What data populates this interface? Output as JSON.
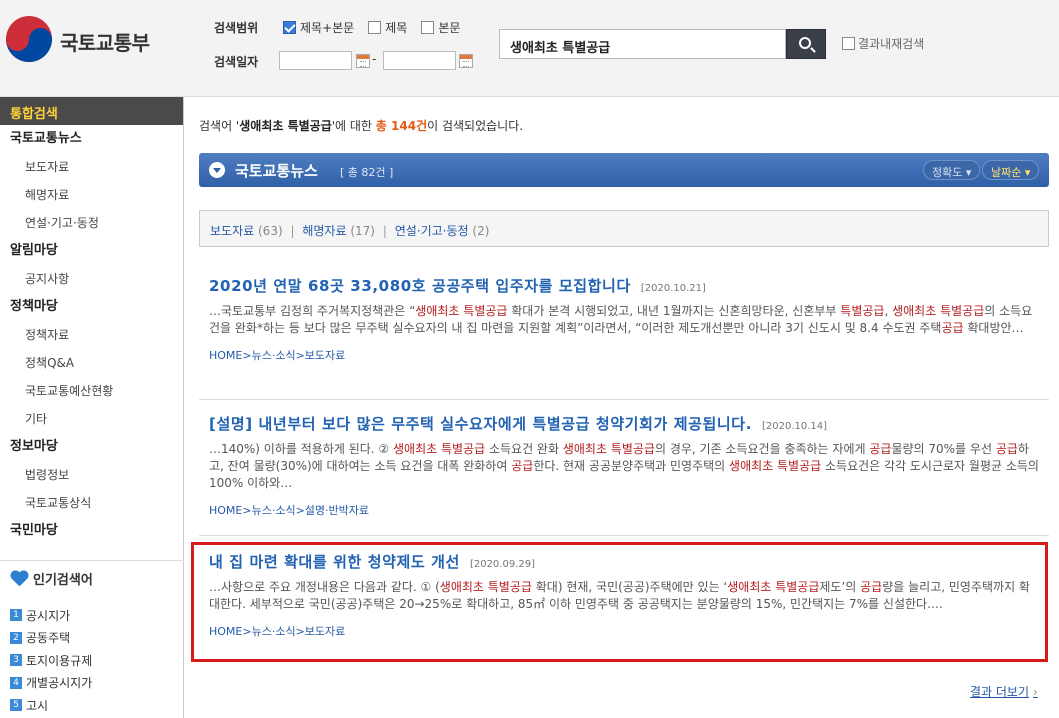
{
  "header": {
    "logo_text": "국토교통부",
    "scope_label": "검색범위",
    "scope_options": [
      {
        "label": "제목+본문",
        "checked": true
      },
      {
        "label": "제목",
        "checked": false
      },
      {
        "label": "본문",
        "checked": false
      }
    ],
    "date_label": "검색일자",
    "date_separator": "-",
    "search_value": "생애최초 특별공급",
    "within_label": "결과내재검색"
  },
  "sidebar": {
    "title": "통합검색",
    "categories": [
      {
        "label": "국토교통뉴스",
        "items": [
          "보도자료",
          "해명자료",
          "연설·기고·동정"
        ]
      },
      {
        "label": "알림마당",
        "items": [
          "공지사항"
        ]
      },
      {
        "label": "정책마당",
        "items": [
          "정책자료",
          "정책Q&A",
          "국토교통예산현황",
          "기타"
        ]
      },
      {
        "label": "정보마당",
        "items": [
          "법령정보",
          "국토교통상식"
        ]
      },
      {
        "label": "국민마당",
        "items": []
      }
    ],
    "popular_title": "인기검색어",
    "popular": [
      {
        "rank": "1",
        "label": "공시지가"
      },
      {
        "rank": "2",
        "label": "공동주택"
      },
      {
        "rank": "3",
        "label": "토지이용규제"
      },
      {
        "rank": "4",
        "label": "개별공시지가"
      },
      {
        "rank": "5",
        "label": "고시"
      }
    ]
  },
  "main": {
    "summary_prefix": "검색어 '",
    "summary_keyword": "생애최초 특별공급",
    "summary_mid": "'에 대한 ",
    "summary_count": "총 144건",
    "summary_suffix": "이 검색되었습니다.",
    "section_title": "국토교통뉴스",
    "section_count": "[ 총 82건 ]",
    "sort_accuracy": "정확도 ▾",
    "sort_date": "날짜순 ▾",
    "filters": [
      {
        "label": "보도자료",
        "count": "(63)"
      },
      {
        "label": "해명자료",
        "count": "(17)"
      },
      {
        "label": "연설·기고·동정",
        "count": "(2)"
      }
    ],
    "results": [
      {
        "title": "2020년 연말 68곳 33,080호 공공주택 입주자를 모집합니다",
        "date": "[2020.10.21]",
        "body": [
          {
            "t": "…국토교통부 김정희 주거복지정책관은 “"
          },
          {
            "t": "생애최초 특별공급",
            "hl": true
          },
          {
            "t": " 확대가 본격 시행되었고, 내년 1월까지는 신혼희망타운, 신혼부부 "
          },
          {
            "t": "특별공급",
            "hl": true
          },
          {
            "t": ", "
          },
          {
            "t": "생애최초 특별공급",
            "hl": true
          },
          {
            "t": "의 소득요건을 완화*하는 등 보다 많은 무주택 실수요자의 내 집 마련을 지원할 계획”이라면서, “이러한 제도개선뿐만 아니라 3기 신도시 및 8.4 수도권 주택"
          },
          {
            "t": "공급",
            "hl": true
          },
          {
            "t": " 확대방안…"
          }
        ],
        "path": "HOME>뉴스·소식>보도자료"
      },
      {
        "title": "[설명] 내년부터 보다 많은 무주택 실수요자에게 특별공급 청약기회가 제공됩니다.",
        "date": "[2020.10.14]",
        "body": [
          {
            "t": "…140%) 이하를 적용하게 된다. ② "
          },
          {
            "t": "생애최초 특별공급",
            "hl": true
          },
          {
            "t": " 소득요건 완화 "
          },
          {
            "t": "생애최초 특별공급",
            "hl": true
          },
          {
            "t": "의 경우, 기존 소득요건을 충족하는 자에게 "
          },
          {
            "t": "공급",
            "hl": true
          },
          {
            "t": "물량의 70%를 우선 "
          },
          {
            "t": "공급",
            "hl": true
          },
          {
            "t": "하고, 잔여 물량(30%)에 대하여는 소득 요건을 대폭 완화하여 "
          },
          {
            "t": "공급",
            "hl": true
          },
          {
            "t": "한다. 현재 공공분양주택과 민영주택의 "
          },
          {
            "t": "생애최초 특별공급",
            "hl": true
          },
          {
            "t": " 소득요건은 각각 도시근로자 월평균 소득의 100% 이하와…"
          }
        ],
        "path": "HOME>뉴스·소식>설명·반박자료"
      },
      {
        "title": "내 집 마련 확대를 위한 청약제도 개선",
        "date": "[2020.09.29]",
        "body": [
          {
            "t": "…사항으로 주요 개정내용은 다음과 같다. ① ("
          },
          {
            "t": "생애최초 특별공급",
            "hl": true
          },
          {
            "t": " 확대) 현재, 국민(공공)주택에만 있는 ‘"
          },
          {
            "t": "생애최초 특별공급",
            "hl": true
          },
          {
            "t": "제도’의 "
          },
          {
            "t": "공급",
            "hl": true
          },
          {
            "t": "량을 늘리고, 민영주택까지 확대한다. 세부적으로 국민(공공)주택은 20→25%로 확대하고, 85㎡ 이하 민영주택 중 공공택지는 분양물량의 15%, 민간택지는 7%를 신설한다.…"
          }
        ],
        "path": "HOME>뉴스·소식>보도자료"
      }
    ],
    "more_label": "결과 더보기"
  }
}
